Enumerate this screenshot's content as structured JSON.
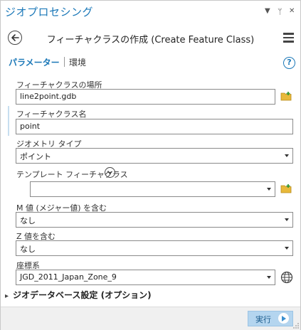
{
  "pane": {
    "title": "ジオプロセシング",
    "controls": {
      "dropdown": "▼",
      "pin": "ᛘ",
      "close": "✕"
    }
  },
  "header": {
    "title": "フィーチャクラスの作成 (Create Feature Class)"
  },
  "tabs": {
    "parameters": "パラメーター",
    "environments": "環境"
  },
  "help": "?",
  "params": {
    "location": {
      "label": "フィーチャクラスの場所",
      "value": "line2point.gdb"
    },
    "name": {
      "label": "フィーチャクラス名",
      "value": "point"
    },
    "geometry": {
      "label": "ジオメトリ タイプ",
      "value": "ポイント"
    },
    "template": {
      "label": "テンプレート フィーチャクラス",
      "value": ""
    },
    "m_values": {
      "label": "M 値 (メジャー値) を含む",
      "value": "なし"
    },
    "z_values": {
      "label": "Z 値を含む",
      "value": "なし"
    },
    "crs": {
      "label": "座標系",
      "value": "JGD_2011_Japan_Zone_9"
    }
  },
  "section": {
    "label": "ジオデータベース設定 (オプション)"
  },
  "footer": {
    "run_label": "実行"
  },
  "colors": {
    "accent": "#1b78b8",
    "run_bg": "#b4d5ef",
    "folder": "#e8b93a"
  }
}
